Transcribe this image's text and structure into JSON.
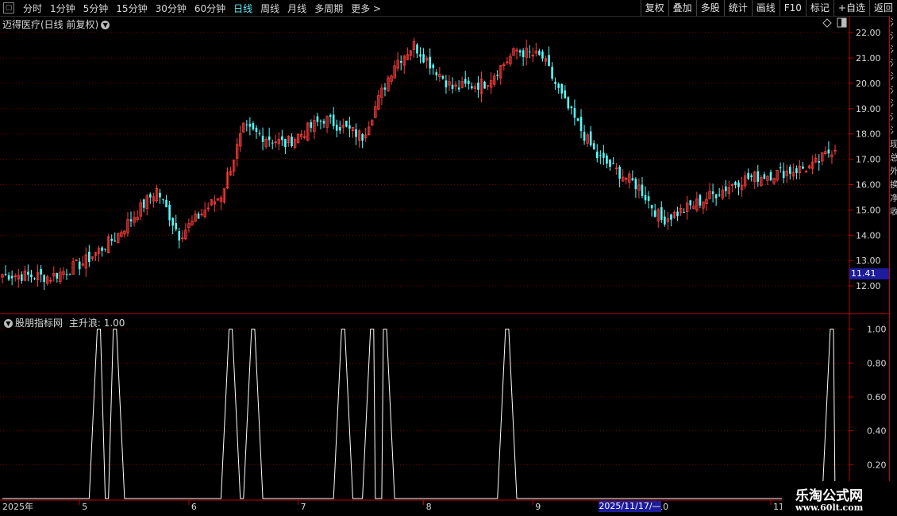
{
  "toolbar": {
    "periods": [
      "分时",
      "1分钟",
      "5分钟",
      "15分钟",
      "30分钟",
      "60分钟",
      "日线",
      "周线",
      "月线",
      "多周期",
      "更多 >"
    ],
    "active_period": "日线",
    "buttons": [
      "复权",
      "叠加",
      "多股",
      "统计",
      "画线",
      "F10",
      "标记",
      "+自选",
      "返回"
    ]
  },
  "main_chart": {
    "title": "迈得医疗(日线 前复权)",
    "price_label": "11.41",
    "colors": {
      "up": "#ff3c3c",
      "down": "#54ffff",
      "grid": "#7a0000",
      "axis": "#c00000"
    }
  },
  "indicator": {
    "title": "股朋指标网",
    "series_label": "主升浪: 1.00"
  },
  "x_axis": {
    "labels": [
      "2025年",
      "5",
      "6",
      "7",
      "8",
      "9",
      "10",
      "11",
      "1"
    ],
    "cursor_date": "2025/11/17/—"
  },
  "right_strip_chars": [
    "氵",
    "氵",
    "氵",
    "氵",
    "氵",
    "氵",
    "氵",
    "氵",
    "氵",
    "现",
    "总",
    "外",
    "换",
    "净",
    "收"
  ],
  "watermark": {
    "line1": "乐淘公式网",
    "line2": "www.60lt.com"
  },
  "chart_data": [
    {
      "type": "candlestick",
      "title": "迈得医疗(日线 前复权)",
      "yticks": [
        12.0,
        13.0,
        14.0,
        15.0,
        16.0,
        17.0,
        18.0,
        19.0,
        20.0,
        21.0,
        22.0
      ],
      "ylim": [
        11.0,
        22.6
      ],
      "x_labels": [
        "2025年",
        "5",
        "6",
        "7",
        "8",
        "9",
        "10",
        "11",
        "1"
      ],
      "keypoints_close": [
        {
          "t": 0,
          "v": 12.45
        },
        {
          "t": 15,
          "v": 12.35
        },
        {
          "t": 25,
          "v": 12.9
        },
        {
          "t": 35,
          "v": 13.9
        },
        {
          "t": 48,
          "v": 15.8
        },
        {
          "t": 55,
          "v": 14.0
        },
        {
          "t": 68,
          "v": 15.6
        },
        {
          "t": 75,
          "v": 18.2
        },
        {
          "t": 88,
          "v": 17.6
        },
        {
          "t": 100,
          "v": 18.6
        },
        {
          "t": 112,
          "v": 17.9
        },
        {
          "t": 122,
          "v": 20.8
        },
        {
          "t": 128,
          "v": 21.5
        },
        {
          "t": 140,
          "v": 19.8
        },
        {
          "t": 150,
          "v": 20.0
        },
        {
          "t": 160,
          "v": 21.3
        },
        {
          "t": 168,
          "v": 21.0
        },
        {
          "t": 175,
          "v": 19.2
        },
        {
          "t": 185,
          "v": 17.1
        },
        {
          "t": 198,
          "v": 15.9
        },
        {
          "t": 205,
          "v": 14.6
        },
        {
          "t": 212,
          "v": 15.0
        },
        {
          "t": 230,
          "v": 16.2
        },
        {
          "t": 252,
          "v": 16.7
        },
        {
          "t": 259,
          "v": 17.5
        }
      ],
      "count": 260
    },
    {
      "type": "line",
      "title": "股朋指标网",
      "series": [
        {
          "name": "主升浪",
          "spikes_t": [
            30,
            35,
            71,
            78,
            106,
            115,
            119,
            157,
            258
          ]
        }
      ],
      "yticks": [
        0.2,
        0.4,
        0.6,
        0.8,
        1.0
      ],
      "ylim": [
        0,
        1.05
      ]
    }
  ]
}
